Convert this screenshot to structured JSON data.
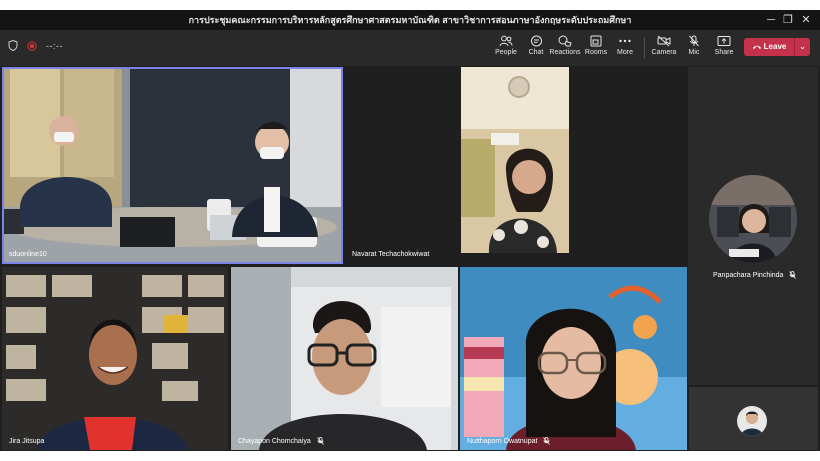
{
  "window": {
    "title": "การประชุมคณะกรรมการบริหารหลักสูตรศึกษาศาสตรมหาบัณฑิต สาขาวิชาการสอนภาษาอังกฤษระดับประถมศึกษา",
    "controls": {
      "minimize": "─",
      "restore": "❐",
      "close": "✕"
    }
  },
  "toolbar": {
    "timer": "--:--",
    "buttons": [
      {
        "label": "People",
        "icon": "people-icon"
      },
      {
        "label": "Chat",
        "icon": "chat-icon"
      },
      {
        "label": "Reactions",
        "icon": "reactions-icon"
      },
      {
        "label": "Rooms",
        "icon": "rooms-icon"
      },
      {
        "label": "More",
        "icon": "more-icon"
      },
      {
        "label": "Camera",
        "icon": "camera-icon"
      },
      {
        "label": "Mic",
        "icon": "mic-off-icon"
      },
      {
        "label": "Share",
        "icon": "share-icon"
      }
    ],
    "leave_label": "Leave",
    "leave_icon": "phone-hangup-icon"
  },
  "participants": [
    {
      "name": "sduonline10",
      "muted": false,
      "active_speaker": true
    },
    {
      "name": "Navarat Techachokwiwat",
      "muted": false
    },
    {
      "name": "Panpachara Pinchinda",
      "muted": true
    },
    {
      "name": "Jira Jitsupa",
      "muted": false
    },
    {
      "name": "Chayapon Chomchaiya",
      "muted": true
    },
    {
      "name": "Nutthaporn Owatnupat",
      "muted": true
    }
  ],
  "colors": {
    "accent_frame": "#7b83eb",
    "leave": "#c4314b",
    "toolbar": "#292929",
    "stage": "#1f1f1f"
  }
}
